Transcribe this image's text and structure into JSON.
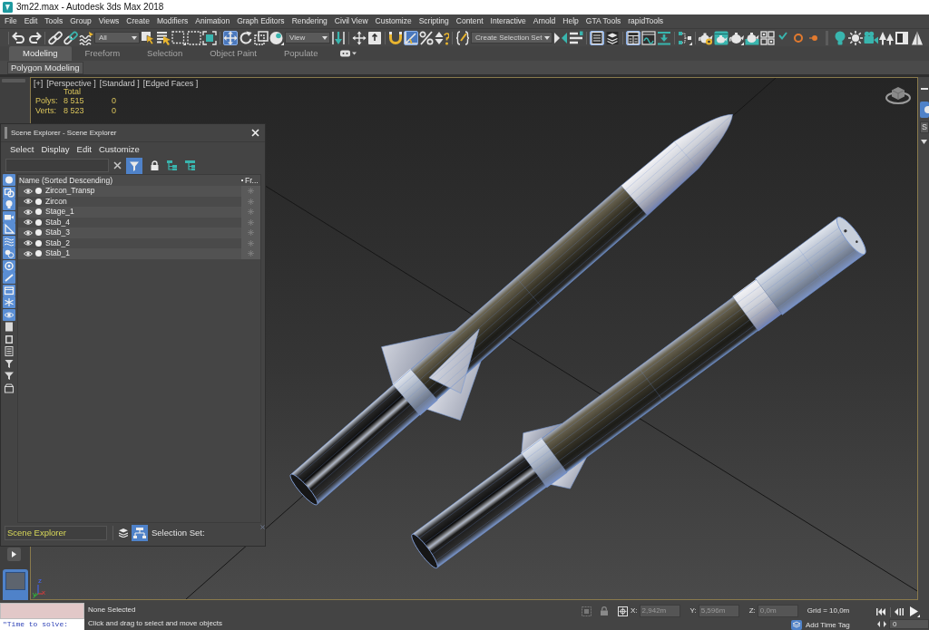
{
  "window": {
    "title": "3m22.max - Autodesk 3ds Max 2018"
  },
  "menu_bar": [
    "File",
    "Edit",
    "Tools",
    "Group",
    "Views",
    "Create",
    "Modifiers",
    "Animation",
    "Graph Editors",
    "Rendering",
    "Civil View",
    "Customize",
    "Scripting",
    "Content",
    "Interactive",
    "Arnold",
    "Help",
    "GTA Tools",
    "rapidTools"
  ],
  "main_toolbar": {
    "selection_filter": "All",
    "reference_coordinate_system": "View",
    "named_selection_set": "Create Selection Set",
    "buttons": [
      {
        "selected": false
      },
      {
        "selected": false
      },
      {
        "selected": false
      },
      {
        "selected": false
      },
      {
        "selected": false
      },
      {
        "selected": false
      },
      {
        "selected": false
      },
      {
        "selected": false
      },
      {
        "selected": false
      },
      {
        "selected": false
      },
      {
        "selected": true
      },
      {
        "selected": false
      },
      {
        "selected": false
      },
      {
        "selected": false
      },
      {
        "selected": false
      },
      {
        "selected": false
      },
      {
        "selected": false
      },
      {
        "selected": false
      },
      {
        "selected": true
      },
      {
        "selected": false
      },
      {
        "selected": false
      },
      {
        "selected": false
      },
      {
        "selected": false
      },
      {
        "selected": false
      },
      {
        "selected": true
      },
      {
        "selected": false
      },
      {
        "selected": true
      },
      {
        "selected": false
      },
      {
        "selected": false
      },
      {
        "selected": false
      },
      {
        "selected": false
      },
      {
        "selected": false
      },
      {
        "selected": false
      },
      {
        "selected": false
      },
      {
        "selected": false
      },
      {
        "selected": false
      },
      {
        "selected": false
      },
      {
        "selected": false
      },
      {
        "selected": false
      },
      {
        "selected": false
      },
      {
        "selected": false
      },
      {
        "selected": false
      },
      {
        "selected": false
      },
      {
        "selected": false
      }
    ]
  },
  "ribbon": {
    "tabs": [
      {
        "label": "Modeling",
        "selected": true
      },
      {
        "label": "Freeform",
        "selected": false
      },
      {
        "label": "Selection",
        "selected": false
      },
      {
        "label": "Object Paint",
        "selected": false
      },
      {
        "label": "Populate",
        "selected": false
      }
    ],
    "panel_button": "Polygon Modeling"
  },
  "viewport": {
    "labels": [
      "[+]",
      "[Perspective ]",
      "[Standard ]",
      "[Edged Faces ]"
    ],
    "statistics": {
      "header": "Total",
      "rows": [
        {
          "label": "Polys:",
          "values": [
            "8 515",
            "0"
          ]
        },
        {
          "label": "Verts:",
          "values": [
            "8 523",
            "0"
          ]
        }
      ]
    },
    "axis_labels": [
      "z",
      "y",
      "x"
    ]
  },
  "scene_explorer": {
    "title": "Scene Explorer - Scene Explorer",
    "menu": [
      "Select",
      "Display",
      "Edit",
      "Customize"
    ],
    "toolbar_buttons": [
      {
        "selected": true
      },
      {
        "selected": false
      },
      {
        "selected": false
      },
      {
        "selected": false
      }
    ],
    "display_filters": [
      {
        "selected": true
      },
      {
        "selected": true
      },
      {
        "selected": true
      },
      {
        "selected": true
      },
      {
        "selected": true
      },
      {
        "selected": true
      },
      {
        "selected": true
      },
      {
        "selected": true
      },
      {
        "selected": true
      },
      {
        "selected": true
      },
      {
        "selected": true
      },
      {
        "selected": true
      },
      {
        "selected": false
      },
      {
        "selected": false
      },
      {
        "selected": false
      },
      {
        "selected": false
      },
      {
        "selected": false
      },
      {
        "selected": false
      }
    ],
    "columns": [
      "Name (Sorted Descending)",
      "Fr..."
    ],
    "rows": [
      {
        "name": "Zircon_Transp",
        "visible": true,
        "frozen": false
      },
      {
        "name": "Zircon",
        "visible": true,
        "frozen": false
      },
      {
        "name": "Stage_1",
        "visible": true,
        "frozen": false
      },
      {
        "name": "Stab_4",
        "visible": true,
        "frozen": false
      },
      {
        "name": "Stab_3",
        "visible": true,
        "frozen": false
      },
      {
        "name": "Stab_2",
        "visible": true,
        "frozen": false
      },
      {
        "name": "Stab_1",
        "visible": true,
        "frozen": false
      }
    ],
    "explorer": "Scene Explorer",
    "selection_set_button": {
      "selected": true
    },
    "selection_set_label": "Selection Set:"
  },
  "command_panel": {
    "dropdown": "S"
  },
  "status_bar": {
    "listener_output": "\"Time to solve:",
    "selection": "None Selected",
    "prompt": "Click and drag to select and move objects",
    "coordinates": [
      {
        "axis": "X:",
        "value": "2,942m"
      },
      {
        "axis": "Y:",
        "value": "5,596m"
      },
      {
        "axis": "Z:",
        "value": "0,0m"
      }
    ],
    "grid": "Grid = 10,0m",
    "time_tag": "Add Time Tag",
    "frame": "0"
  }
}
